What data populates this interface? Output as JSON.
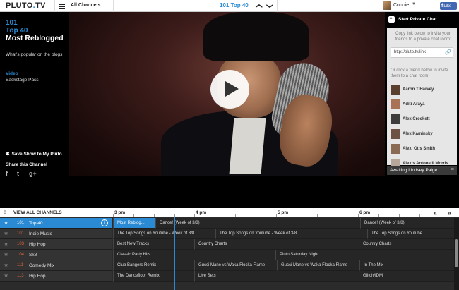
{
  "topbar": {
    "logo_left": "PLUTO",
    "logo_dot": ".",
    "logo_right": "TV",
    "all_channels": "All Channels",
    "current_channel": "101 Top 40",
    "prev_arrow": "❮",
    "next_arrow": "❯",
    "user_name": "Connie",
    "user_caret": "▼",
    "fb_f": "f",
    "fb_like": "Like"
  },
  "left": {
    "channel_number": "101",
    "channel_name": "Top 40",
    "show_title": "Most Reblogged",
    "show_desc": "What's popular on the blogs",
    "type_label": "Video",
    "type_value": "Backstage Pass",
    "save_show": "Save Show to My Pluto",
    "share_label": "Share this Channel",
    "social": {
      "facebook": "f",
      "twitter": "t",
      "google": "g+"
    }
  },
  "chat": {
    "icon": "•••",
    "title": "Start Private Chat",
    "copy_text": "Copy link below to invite your friends to a private chat room:",
    "link_value": "http://pluto.tv/link",
    "link_icon": "🔗",
    "or_text": "Or click a friend below to invite them to a chat room:",
    "friends": [
      {
        "name": "Aaron T Harvey"
      },
      {
        "name": "Aditi Araya"
      },
      {
        "name": "Alex Crockett"
      },
      {
        "name": "Alex Kaminsky"
      },
      {
        "name": "Alexi Otis Smith"
      },
      {
        "name": "Alexis Antonelli Morris"
      }
    ],
    "awaiting": "Awaiting Lindsey Paige",
    "close": "×"
  },
  "guide": {
    "share_icon": "⇪",
    "view_all": "VIEW ALL CHANNELS",
    "times": [
      "3 pm",
      "4 pm",
      "5 pm",
      "6 pm"
    ],
    "nav_back": "«",
    "nav_fwd": "»",
    "rows": [
      {
        "star": "★",
        "num": "101",
        "name": "Top 40",
        "info": "i",
        "active": true,
        "programs": [
          "Most Reblog...",
          "Dance! (Week of 3/8)",
          "Dance! (Week of 3/8)"
        ]
      },
      {
        "star": "★",
        "num": "101",
        "name": "Indie Music",
        "programs": [
          "The Top Songs on Youtube - Week of 3/8",
          "The Top Songs on Youtube - Week of 3/8",
          "The Top Songs on Youtube"
        ]
      },
      {
        "star": "★",
        "num": "103",
        "name": "Hip Hop",
        "programs": [
          "Best New Tracks",
          "Country Charts",
          "Country Charts"
        ]
      },
      {
        "star": "★",
        "num": "104",
        "name": "Sk8",
        "programs": [
          "Classic Party Hits",
          "Pluto Saturday Night"
        ]
      },
      {
        "star": "★",
        "num": "111",
        "name": "Comedy Mix",
        "programs": [
          "Club Bangers Remix",
          "Gucci Mane vs Waka Flocka Flame",
          "Gucci Mane vs Waka Flocka Flame",
          "In The Mix"
        ]
      },
      {
        "star": "★",
        "num": "113",
        "name": "Hip Hop",
        "programs": [
          "The Dancefloor Remix",
          "Live Sets",
          "Glitch/IDM"
        ]
      }
    ]
  },
  "colors": {
    "accent": "#2a8ad3",
    "channel_number": "#e0603a",
    "fb": "#4267b2"
  }
}
